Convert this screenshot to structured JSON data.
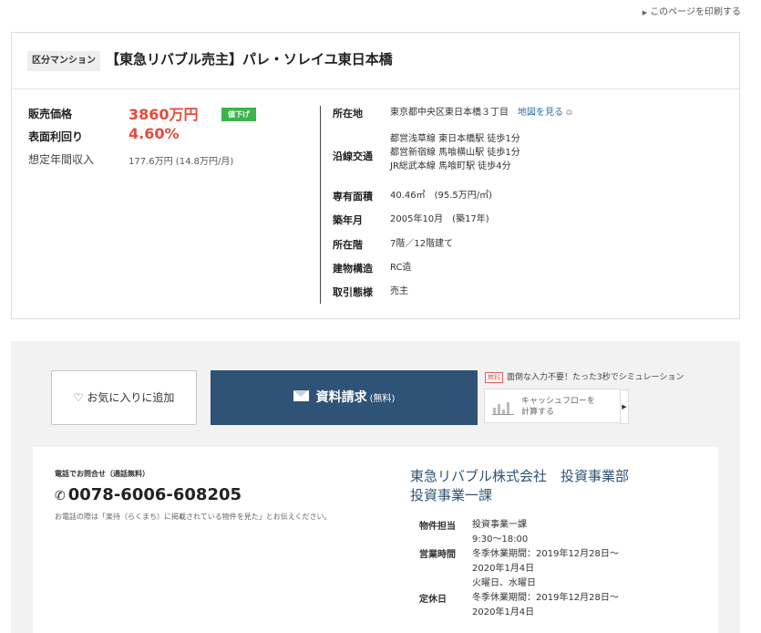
{
  "print_link": "このページを印刷する",
  "property": {
    "type_badge": "区分マンション",
    "title": "【東急リバブル売主】パレ・ソレイユ東日本橋",
    "price_label": "販売価格",
    "price": "3860万円",
    "price_badge": "値下げ",
    "yield_label": "表面利回り",
    "yield": "4.60%",
    "income_label": "想定年間収入",
    "income": "177.6万円 (14.8万円/月)",
    "specs": {
      "location_label": "所在地",
      "location": "東京都中央区東日本橋３丁目",
      "map_link": "地図を見る",
      "transport_label": "沿線交通",
      "transport": [
        "都営浅草線 東日本橋駅 徒歩1分",
        "都営新宿線 馬喰横山駅 徒歩1分",
        "JR総武本線 馬喰町駅 徒歩4分"
      ],
      "area_label": "専有面積",
      "area": "40.46㎡　(95.5万円/㎡)",
      "built_label": "築年月",
      "built": "2005年10月　(築17年)",
      "floor_label": "所在階",
      "floor": "7階／12階建て",
      "structure_label": "建物構造",
      "structure": "RC造",
      "deal_label": "取引態様",
      "deal": "売主"
    }
  },
  "actions": {
    "favorite": "お気に入りに追加",
    "request": "資料請求",
    "request_free": "(無料)",
    "promo_tag": "無料",
    "promo_text": "面倒な入力不要！たった3秒でシミュレーション",
    "cashflow_line1": "キャッシュフローを",
    "cashflow_line2": "計算する"
  },
  "contact": {
    "tel_caption": "電話でお問合せ（通話無料）",
    "tel_number": "0078-6006-608205",
    "tel_note": "お電話の際は「楽待（らくまち）に掲載されている物件を見た」とお伝えください。",
    "company_line1": "東急リバブル株式会社　投資事業部",
    "company_line2": "投資事業一課",
    "staff_label": "物件担当",
    "staff": "投資事業一課",
    "hours_label": "営業時間",
    "hours": [
      "9:30～18:00",
      "冬季休業期間：2019年12月28日～",
      "2020年1月4日"
    ],
    "holiday_label": "定休日",
    "holiday": [
      "火曜日、水曜日",
      "冬季休業期間：2019年12月28日～",
      "2020年1月4日"
    ]
  },
  "colors": {
    "accent_red": "#e34c3a",
    "navy": "#2f5377",
    "badge_green": "#3cb44b"
  }
}
